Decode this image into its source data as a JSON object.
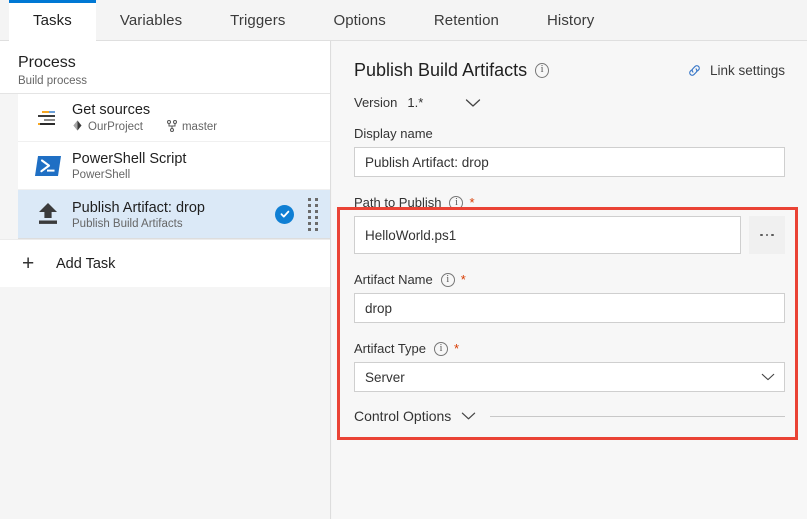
{
  "tabs": [
    {
      "label": "Tasks",
      "active": true
    },
    {
      "label": "Variables",
      "active": false
    },
    {
      "label": "Triggers",
      "active": false
    },
    {
      "label": "Options",
      "active": false
    },
    {
      "label": "Retention",
      "active": false
    },
    {
      "label": "History",
      "active": false
    }
  ],
  "left_pane": {
    "process": {
      "title": "Process",
      "subtitle": "Build process"
    },
    "tasks": [
      {
        "name": "Get sources",
        "icon": "get-sources-icon",
        "repo": "OurProject",
        "branch": "master",
        "selected": false
      },
      {
        "name": "PowerShell Script",
        "icon": "powershell-icon",
        "subtitle": "PowerShell",
        "selected": false
      },
      {
        "name": "Publish Artifact: drop",
        "icon": "publish-upload-icon",
        "subtitle": "Publish Build Artifacts",
        "selected": true,
        "status": "enabled-check"
      }
    ],
    "add_task": {
      "label": "Add Task",
      "icon": "plus-icon"
    }
  },
  "right_pane": {
    "title": "Publish Build Artifacts",
    "title_info_icon": "info-icon",
    "link_settings": {
      "label": "Link settings",
      "icon": "link-icon"
    },
    "version": {
      "label": "Version",
      "value": "1.*",
      "caret_icon": "chevron-down-icon"
    },
    "fields": [
      {
        "label": "Display name",
        "value": "Publish Artifact: drop",
        "required": false,
        "has_info": false,
        "type": "text"
      },
      {
        "label": "Path to Publish",
        "value": "HelloWorld.ps1",
        "required": true,
        "required_mark": "*",
        "has_info": true,
        "type": "text-with-browse",
        "browse_icon": "ellipsis-icon"
      },
      {
        "label": "Artifact Name",
        "value": "drop",
        "required": true,
        "required_mark": "*",
        "has_info": true,
        "type": "text"
      },
      {
        "label": "Artifact Type",
        "value": "Server",
        "required": true,
        "required_mark": "*",
        "has_info": true,
        "type": "select",
        "caret_icon": "chevron-down-icon"
      }
    ],
    "control_options": {
      "label": "Control Options",
      "caret_icon": "chevron-down-icon"
    }
  },
  "colors": {
    "accent_blue": "#0078d4",
    "selected_row": "#dbe9f7",
    "highlight_red": "#ea4335",
    "required_star": "#d83b01",
    "powershell_blue": "#1f6fc4"
  }
}
